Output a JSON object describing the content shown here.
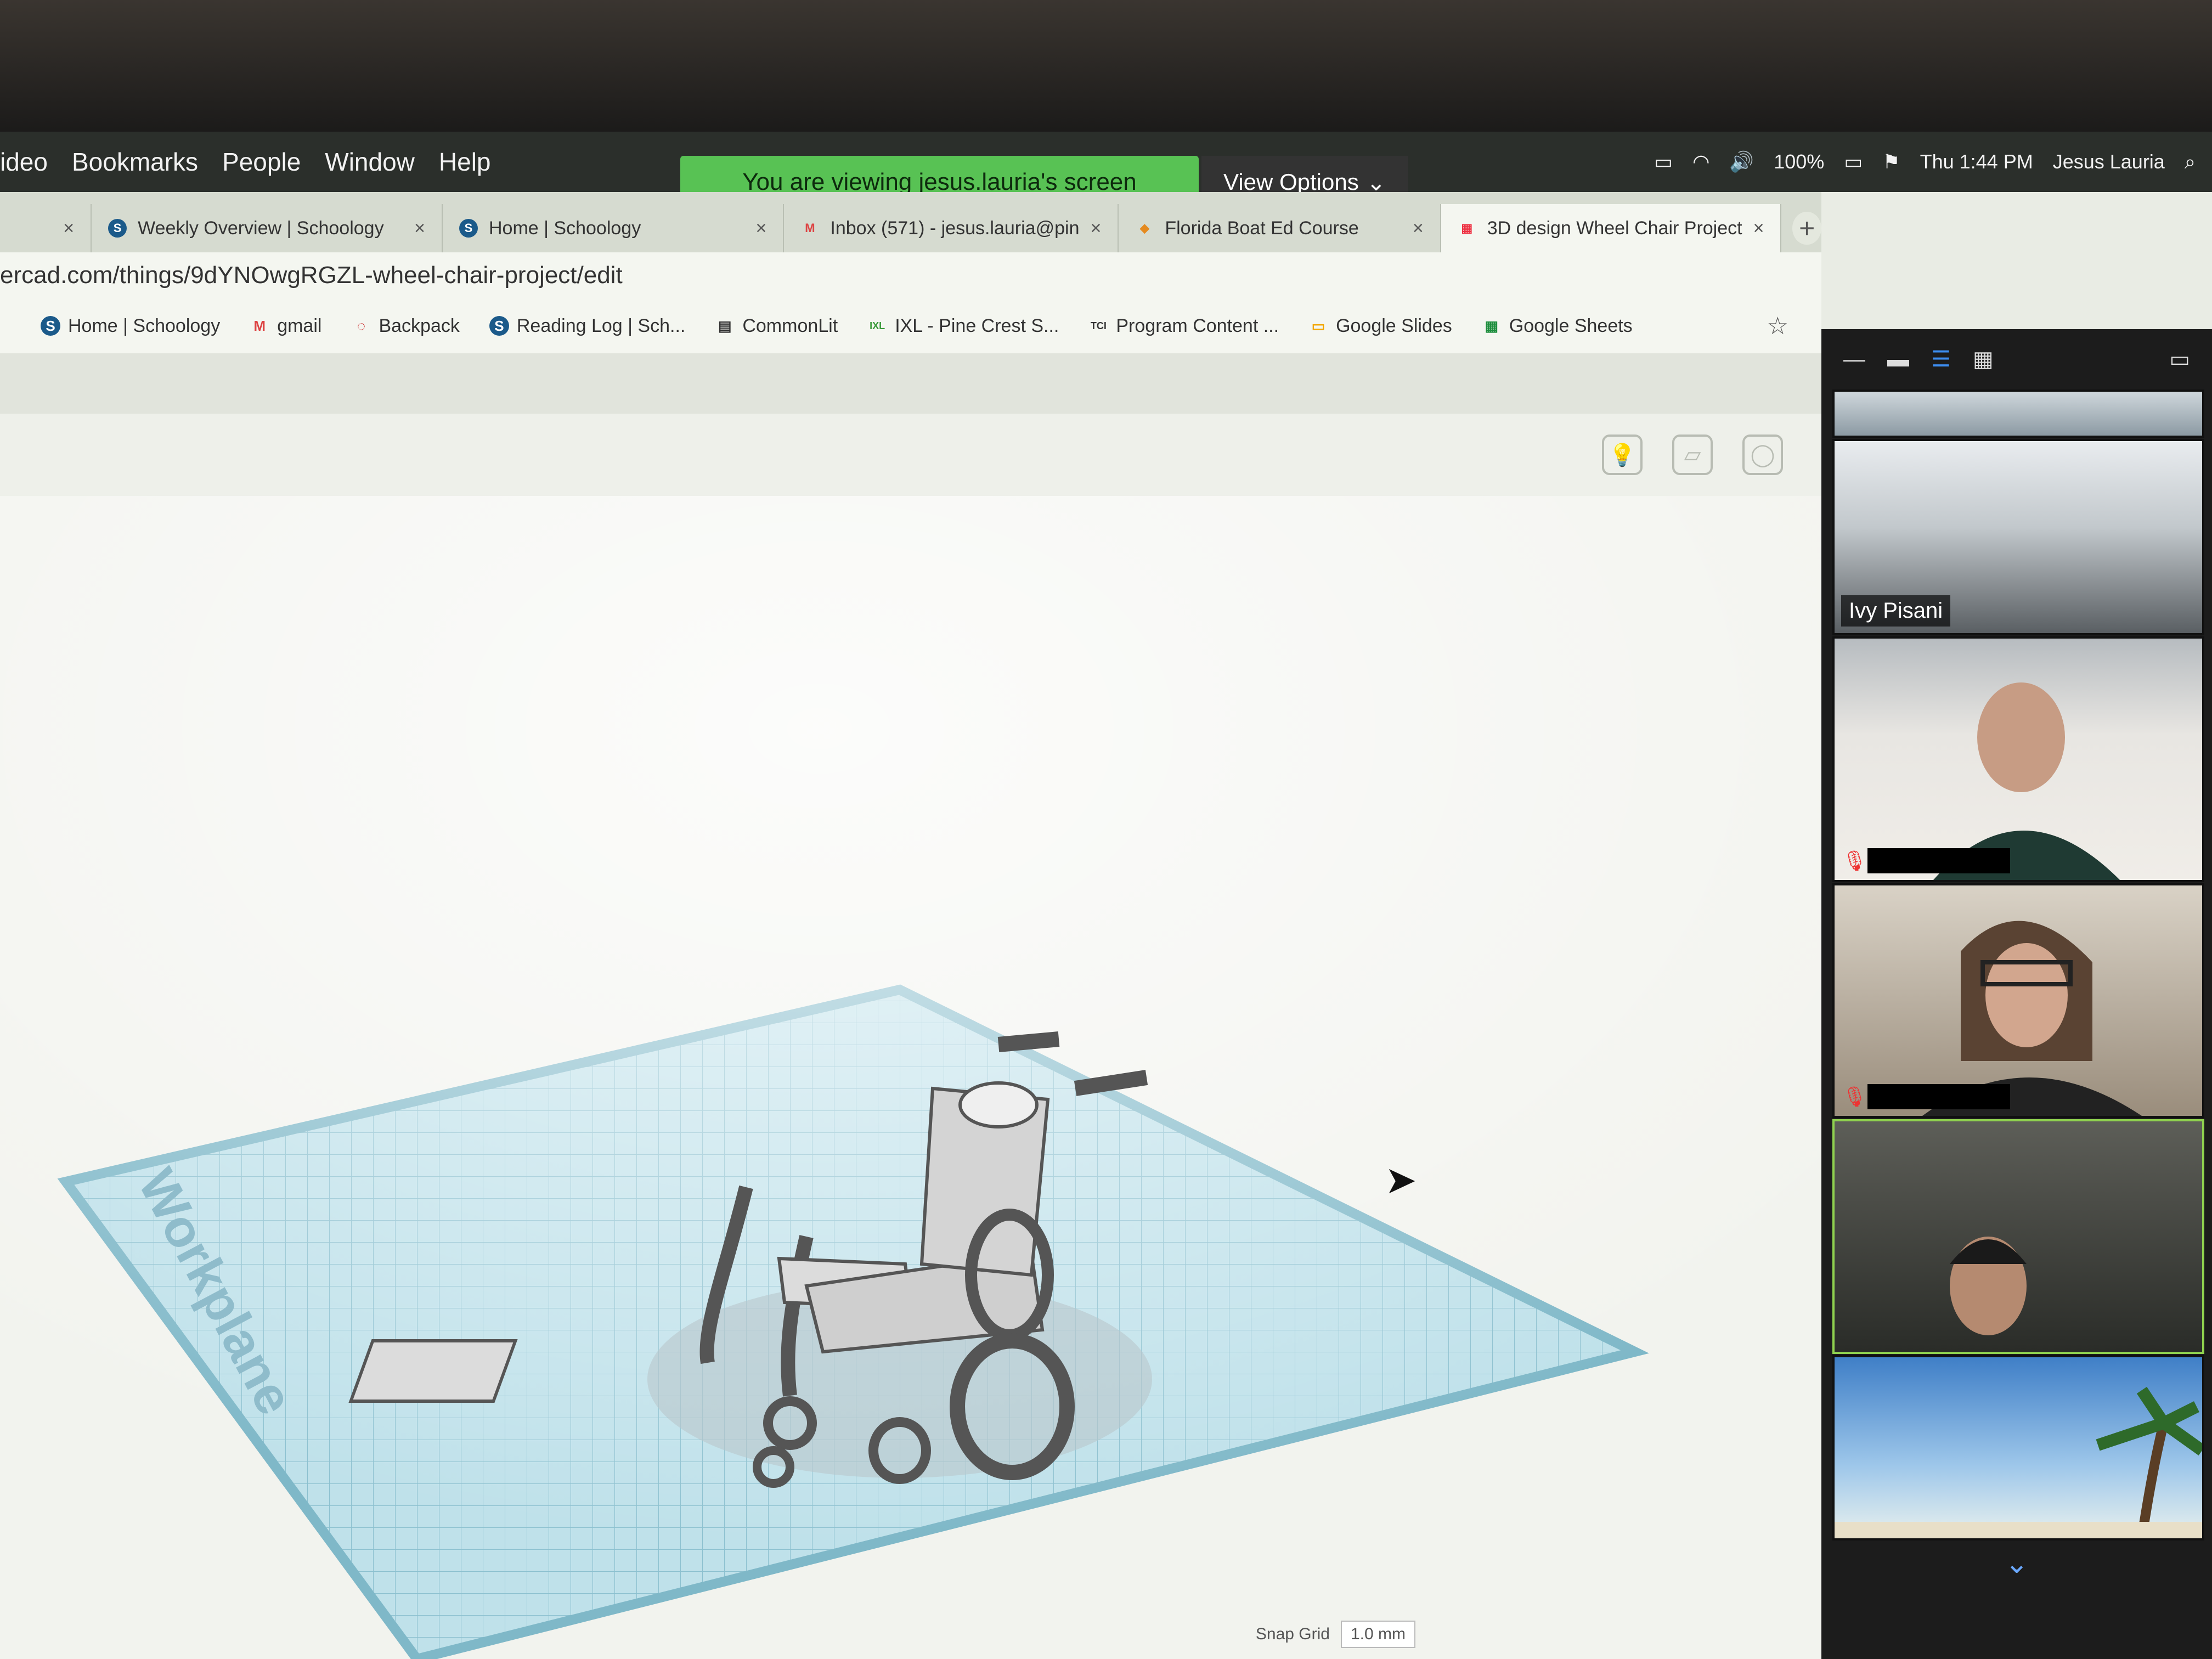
{
  "menubar": {
    "app_fragment": "ideo",
    "items": [
      "Bookmarks",
      "People",
      "Window",
      "Help"
    ],
    "battery": "100%",
    "clock": "Thu 1:44 PM",
    "user": "Jesus Lauria"
  },
  "zoom": {
    "banner": "You are viewing jesus.lauria's screen",
    "view_options": "View Options",
    "participants": [
      {
        "name": "Ivy Pisani"
      }
    ]
  },
  "tabs": [
    {
      "label": "Weekly Overview | Schoology",
      "icon": "S"
    },
    {
      "label": "Home | Schoology",
      "icon": "S"
    },
    {
      "label": "Inbox (571) - jesus.lauria@pin",
      "icon": "M"
    },
    {
      "label": "Florida Boat Ed Course",
      "icon": "◆"
    },
    {
      "label": "3D design Wheel Chair Project",
      "icon": "▦",
      "active": true
    }
  ],
  "url": "ercad.com/things/9dYNOwgRGZL-wheel-chair-project/edit",
  "bookmarks": [
    {
      "label": "Home | Schoology",
      "icon": "S"
    },
    {
      "label": "gmail",
      "icon": "M"
    },
    {
      "label": "Backpack",
      "icon": "◌"
    },
    {
      "label": "Reading Log | Sch...",
      "icon": "S"
    },
    {
      "label": "CommonLit",
      "icon": "▤"
    },
    {
      "label": "IXL - Pine Crest S...",
      "icon": "IXL"
    },
    {
      "label": "Program Content ...",
      "icon": "TCI"
    },
    {
      "label": "Google Slides",
      "icon": "▭"
    },
    {
      "label": "Google Sheets",
      "icon": "▦"
    }
  ],
  "workplane": {
    "label": "Workplane"
  },
  "snap_grid": {
    "label": "Snap Grid",
    "value": "1.0 mm"
  },
  "colors": {
    "banner": "#58c254",
    "grid": "#9fd0dc",
    "active_tile": "#8fd14f"
  }
}
